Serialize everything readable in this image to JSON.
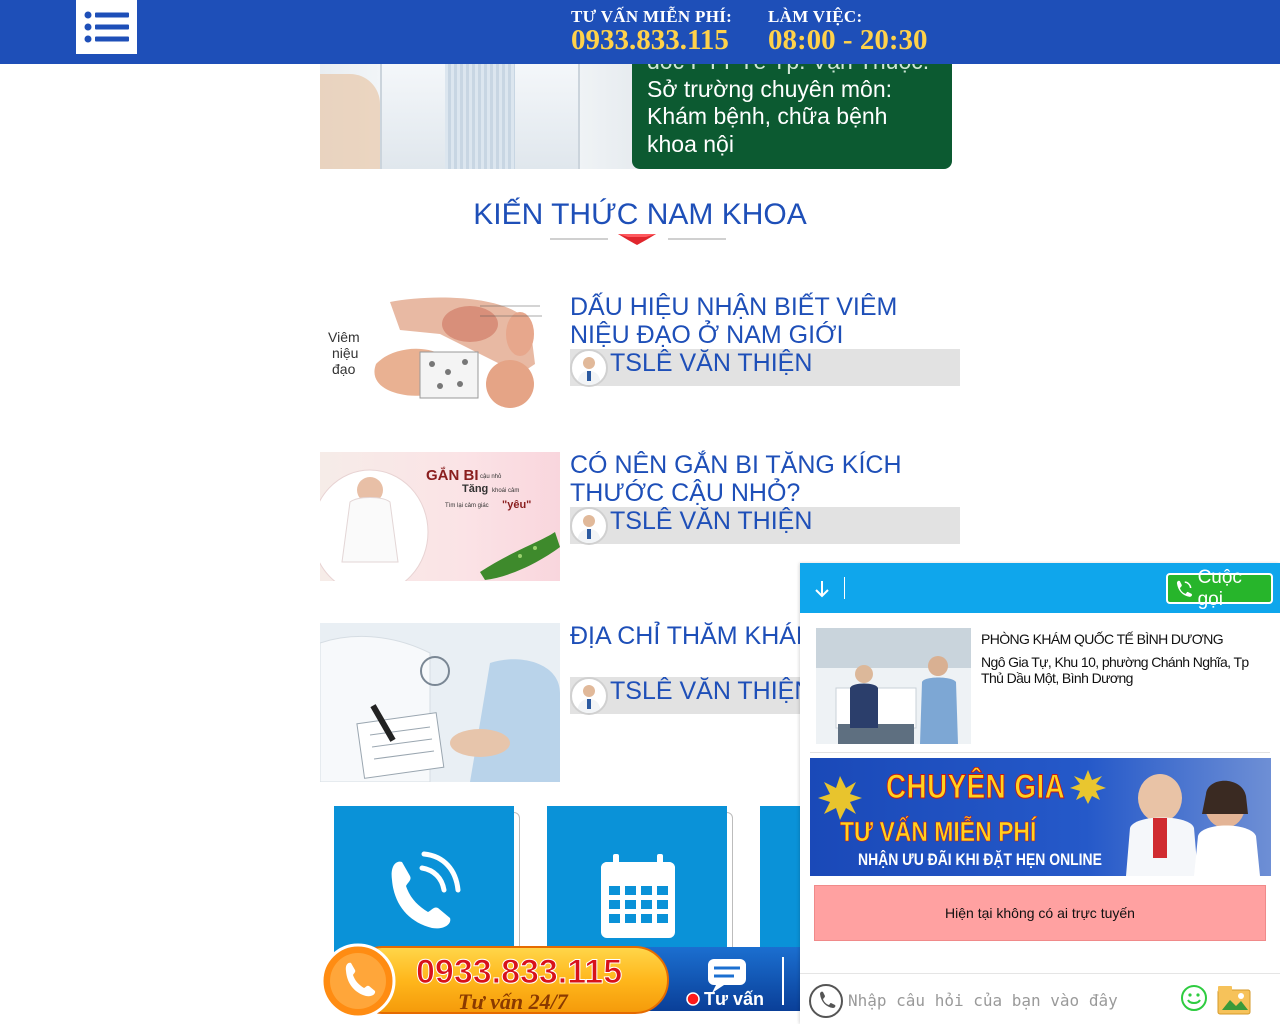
{
  "header": {
    "hotline_label": "TƯ VẤN MIỄN PHÍ:",
    "hotline_number": "0933.833.115",
    "hours_label": "LÀM VIỆC:",
    "hours_value": "08:00 - 20:30",
    "menu_icon": "list-icon"
  },
  "doctor": {
    "line_0": "đốc PTT Tế Tp. Vạn Thuộc.",
    "line_1": "Sở trường chuyên môn:",
    "line_2": "Khám bệnh, chữa bệnh",
    "line_3": "khoa nội"
  },
  "section": {
    "title": "KIẾN THỨC NAM KHOA"
  },
  "articles": [
    {
      "title": "DẤU HIỆU NHẬN BIẾT VIÊM NIỆU ĐẠO Ở NAM GIỚI",
      "author": "TSLÊ VĂN THIỆN",
      "thumb_text": "Viêm\nniệu\nđạo"
    },
    {
      "title": "CÓ NÊN GẮN BI TĂNG KÍCH THƯỚC CẬU NHỎ?",
      "author": "TSLÊ VĂN THIỆN",
      "thumb_title": "GẮN BI",
      "thumb_small1": "cậu nhỏ",
      "thumb_line2": "Tăng",
      "thumb_small2": "khoái cảm",
      "thumb_line3": "Tìm lại cảm giác",
      "thumb_quote": "\"yêu\""
    },
    {
      "title": "ĐỊA CHỈ THĂM KHÁM UY TÍN",
      "author": "TSLÊ VĂN THIỆN"
    }
  ],
  "bottom_banner": {
    "phone": "0933.833.115",
    "tagline": "Tư vấn 24/7",
    "consult_label": "Tư vấn"
  },
  "chat": {
    "call_label": "Cuộc gọi",
    "clinic_name": "PHÒNG KHÁM QUỐC TẾ BÌNH DƯƠNG",
    "clinic_address": "Ngô Gia Tự, Khu 10, phường Chánh Nghĩa, Tp Thủ Dầu Một, Bình Dương",
    "promo_line1": "CHUYÊN GIA",
    "promo_line2": "TƯ VẤN MIỄN PHÍ",
    "promo_line3": "NHẬN ƯU ĐÃI KHI ĐẶT HẸN ONLINE",
    "offline_text": "Hiện tại không có ai trực tuyến",
    "input_placeholder": "Nhập câu hỏi của bạn vào đây"
  },
  "colors": {
    "brand_blue": "#1e4fb8",
    "accent_yellow": "#ffd24a",
    "doctor_green": "#0c5a31",
    "chat_blue": "#0fa6ec",
    "call_green": "#27b52b",
    "offline_pink": "#ffa1a1"
  }
}
